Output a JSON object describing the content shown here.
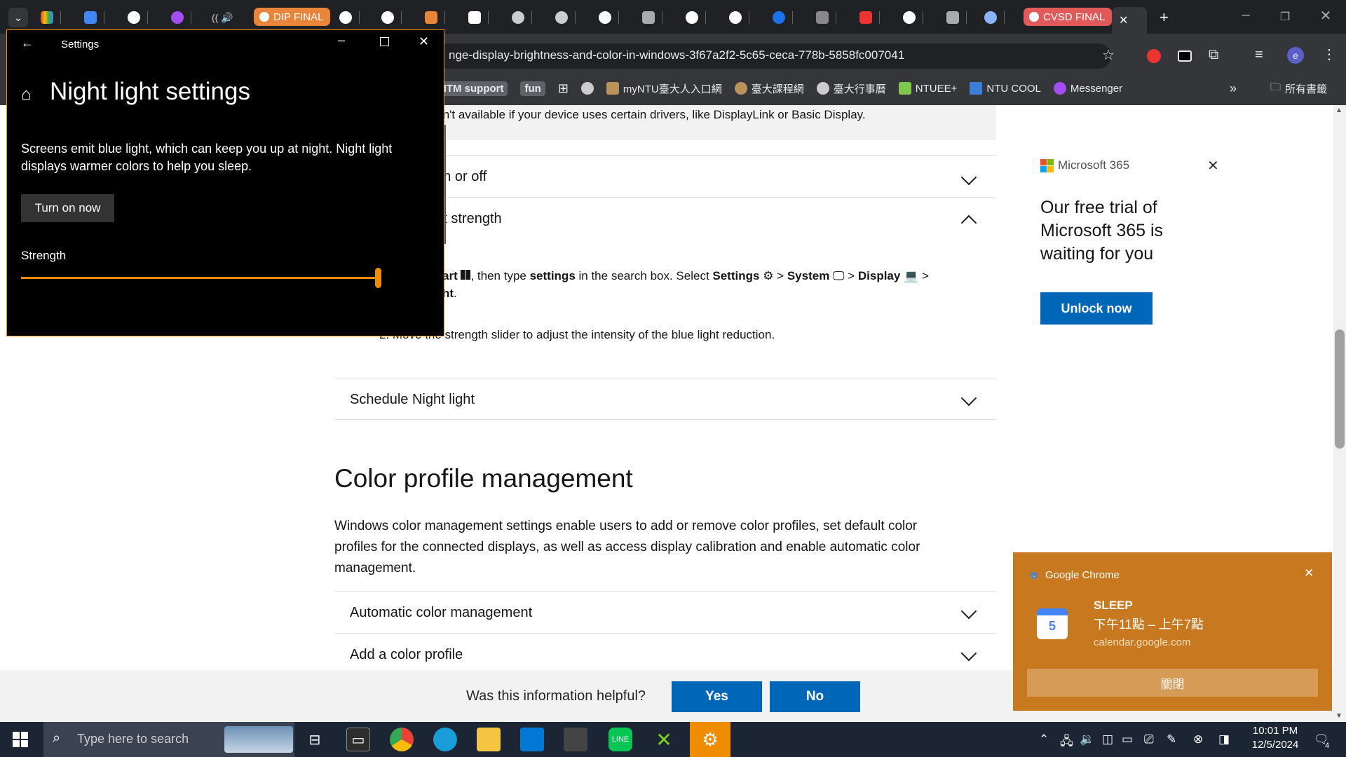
{
  "browser": {
    "pinned_pill_left": "DIP FINAL",
    "pinned_pill_right": "CVSD FINAL",
    "url": "nge-display-brightness-and-color-in-windows-3f67a2f2-5c65-ceca-778b-5858fc007041",
    "bookmarks": [
      "HTM support",
      "fun",
      "myNTU臺大人入口網",
      "臺大課程網",
      "臺大行事曆",
      "NTUEE+",
      "NTU COOL",
      "Messenger"
    ],
    "all_bookmarks": "所有書籤",
    "profile_initial": "e"
  },
  "page": {
    "partial_note": "t isn't available if your device uses certain drivers, like DisplayLink or Basic Display.",
    "row_on_off": "t on or off",
    "row_strength": "ght strength",
    "step1_a": "art",
    "step1_b": ", then type ",
    "step1_settings_word": "settings",
    "step1_c": " in the search box. Select ",
    "step1_settings": "Settings",
    "gt1": ">",
    "step1_system": "System",
    "gt2": ">",
    "step1_display": "Display",
    "gt3": ">",
    "step1_tail": "ht",
    "step1_period": ".",
    "step2": "2.  Move the strength slider to adjust the intensity of the blue light reduction.",
    "row_schedule": "Schedule Night light",
    "section_title": "Color profile management",
    "section_body_1": "Windows color management settings enable users to add or remove color profiles, set default color",
    "section_body_2": "profiles for the connected displays, as well as access display calibration and enable automatic color",
    "section_body_3": "management.",
    "row_auto": "Automatic color management",
    "row_add": "Add a color profile"
  },
  "ad": {
    "brand": "Microsoft 365",
    "headline_1": "Our free trial of",
    "headline_2": "Microsoft 365 is",
    "headline_3": "waiting for you",
    "cta": "Unlock now"
  },
  "feedback": {
    "question": "Was this information helpful?",
    "yes": "Yes",
    "no": "No"
  },
  "settings_window": {
    "app_title": "Settings",
    "heading": "Night light settings",
    "desc_1": "Screens emit blue light, which can keep you up at night. Night light",
    "desc_2": "displays warmer colors to help you sleep.",
    "button": "Turn on now",
    "strength_label": "Strength",
    "strength_value": 1.0,
    "accent": "#f08c00"
  },
  "notification": {
    "app": "Google Chrome",
    "title": "SLEEP",
    "time": "下午11點 – 上午7點",
    "source": "calendar.google.com",
    "calendar_day": "5",
    "dismiss": "關閉"
  },
  "taskbar": {
    "search_placeholder": "Type here to search",
    "time": "10:01 PM",
    "date": "12/5/2024",
    "notif_count": "4"
  }
}
